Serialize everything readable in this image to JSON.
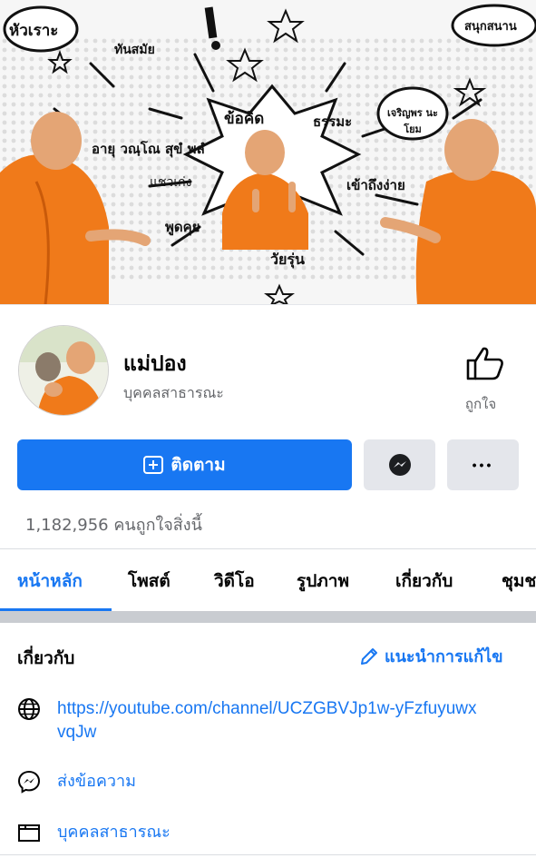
{
  "cover": {
    "words": [
      "หัวเราะ",
      "ทันสมัย",
      "สนุกสนาน",
      "ข้อคิด",
      "ธรรมะ",
      "เจริญพร นะโยม",
      "อายุ วณฺโณ สุขํ พลํ",
      "แชวเก่ง",
      "เข้าถึงง่าย",
      "พูดคุย",
      "วัยรุ่น"
    ]
  },
  "profile": {
    "name": "แม่ปอง",
    "category": "บุคคลสาธารณะ",
    "like_label": "ถูกใจ"
  },
  "actions": {
    "follow_label": "ติดตาม",
    "messenger_icon": "messenger-icon",
    "more_label": "•••"
  },
  "stats": {
    "likes_text": "1,182,956 คนถูกใจสิ่งนี้"
  },
  "tabs": [
    {
      "label": "หน้าหลัก",
      "active": true
    },
    {
      "label": "โพสต์",
      "active": false
    },
    {
      "label": "วิดีโอ",
      "active": false
    },
    {
      "label": "รูปภาพ",
      "active": false
    },
    {
      "label": "เกี่ยวกับ",
      "active": false
    },
    {
      "label": "ชุมช",
      "active": false
    }
  ],
  "about": {
    "title": "เกี่ยวกับ",
    "edit_label": "แนะนำการแก้ไข",
    "youtube_link": "https://youtube.com/channel/UCZGBVJp1w-yFzfuyuwxvqJw",
    "message_label": "ส่งข้อความ",
    "category_label": "บุคคลสาธารณะ"
  },
  "colors": {
    "accent": "#1877f2",
    "robe": "#f07a1a",
    "secondary_text": "#65676b",
    "button_gray": "#e4e6eb"
  }
}
